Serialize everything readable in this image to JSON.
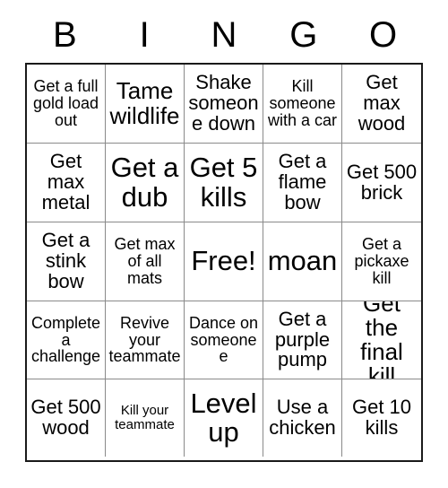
{
  "card": {
    "type": "bingo-card",
    "size": "5x5",
    "header_letters": [
      "B",
      "I",
      "N",
      "G",
      "O"
    ],
    "background_color": "#ffffff",
    "text_color": "#000000",
    "outer_border_color": "#1a1a1a",
    "inner_border_color": "#8a8a8a",
    "free_space_label": "Free!",
    "free_space_position": {
      "row": 3,
      "column": 3
    },
    "rows": [
      [
        {
          "text": "Get a full gold load out",
          "size": "sz-sm"
        },
        {
          "text": "Tame wildlife",
          "size": "sz-lg"
        },
        {
          "text": "Shake someone down",
          "size": "sz-md"
        },
        {
          "text": "Kill someone with a car",
          "size": "sz-sm"
        },
        {
          "text": "Get max wood",
          "size": "sz-md"
        }
      ],
      [
        {
          "text": "Get max metal",
          "size": "sz-md"
        },
        {
          "text": "Get a dub",
          "size": "sz-xl"
        },
        {
          "text": "Get 5 kills",
          "size": "sz-xl"
        },
        {
          "text": "Get a flame bow",
          "size": "sz-md"
        },
        {
          "text": "Get 500 brick",
          "size": "sz-md"
        }
      ],
      [
        {
          "text": "Get a stink bow",
          "size": "sz-md"
        },
        {
          "text": "Get max of all mats",
          "size": "sz-sm"
        },
        {
          "text": "Free!",
          "size": "sz-xl"
        },
        {
          "text": "moan",
          "size": "sz-xl"
        },
        {
          "text": "Get a pickaxe kill",
          "size": "sz-sm"
        }
      ],
      [
        {
          "text": "Complete a challenge",
          "size": "sz-sm"
        },
        {
          "text": "Revive your teammate",
          "size": "sz-sm"
        },
        {
          "text": "Dance on someone e",
          "size": "sz-sm"
        },
        {
          "text": "Get a purple pump",
          "size": "sz-md"
        },
        {
          "text": "Get the final kill",
          "size": "sz-lg"
        }
      ],
      [
        {
          "text": "Get 500 wood",
          "size": "sz-md"
        },
        {
          "text": "Kill your teammate",
          "size": "sz-xs"
        },
        {
          "text": "Level up",
          "size": "sz-xl"
        },
        {
          "text": "Use a chicken",
          "size": "sz-md"
        },
        {
          "text": "Get 10 kills",
          "size": "sz-md"
        }
      ]
    ]
  }
}
